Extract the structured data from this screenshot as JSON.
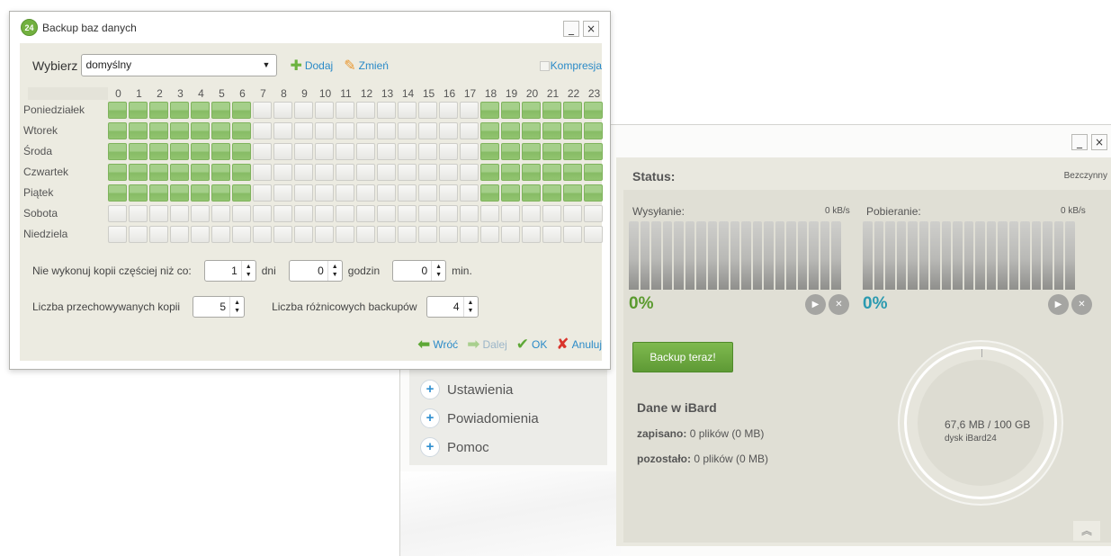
{
  "dialog": {
    "title": "Backup baz danych",
    "logo_text": "24",
    "minimize_label": "_",
    "close_label": "×",
    "wybierz_label": "Wybierz",
    "profile_value": "domyślny",
    "dodaj_label": "Dodaj",
    "zmien_label": "Zmień",
    "kompresja_label": "Kompresja",
    "kompresja_checked": false,
    "hours": [
      "0",
      "1",
      "2",
      "3",
      "4",
      "5",
      "6",
      "7",
      "8",
      "9",
      "10",
      "11",
      "12",
      "13",
      "14",
      "15",
      "16",
      "17",
      "18",
      "19",
      "20",
      "21",
      "22",
      "23"
    ],
    "days": [
      {
        "label": "Poniedziałek",
        "on": [
          1,
          1,
          1,
          1,
          1,
          1,
          1,
          0,
          0,
          0,
          0,
          0,
          0,
          0,
          0,
          0,
          0,
          0,
          1,
          1,
          1,
          1,
          1,
          1
        ]
      },
      {
        "label": "Wtorek",
        "on": [
          1,
          1,
          1,
          1,
          1,
          1,
          1,
          0,
          0,
          0,
          0,
          0,
          0,
          0,
          0,
          0,
          0,
          0,
          1,
          1,
          1,
          1,
          1,
          1
        ]
      },
      {
        "label": "Środa",
        "on": [
          1,
          1,
          1,
          1,
          1,
          1,
          1,
          0,
          0,
          0,
          0,
          0,
          0,
          0,
          0,
          0,
          0,
          0,
          1,
          1,
          1,
          1,
          1,
          1
        ]
      },
      {
        "label": "Czwartek",
        "on": [
          1,
          1,
          1,
          1,
          1,
          1,
          1,
          0,
          0,
          0,
          0,
          0,
          0,
          0,
          0,
          0,
          0,
          0,
          1,
          1,
          1,
          1,
          1,
          1
        ]
      },
      {
        "label": "Piątek",
        "on": [
          1,
          1,
          1,
          1,
          1,
          1,
          1,
          0,
          0,
          0,
          0,
          0,
          0,
          0,
          0,
          0,
          0,
          0,
          1,
          1,
          1,
          1,
          1,
          1
        ]
      },
      {
        "label": "Sobota",
        "on": [
          0,
          0,
          0,
          0,
          0,
          0,
          0,
          0,
          0,
          0,
          0,
          0,
          0,
          0,
          0,
          0,
          0,
          0,
          0,
          0,
          0,
          0,
          0,
          0
        ]
      },
      {
        "label": "Niedziela",
        "on": [
          0,
          0,
          0,
          0,
          0,
          0,
          0,
          0,
          0,
          0,
          0,
          0,
          0,
          0,
          0,
          0,
          0,
          0,
          0,
          0,
          0,
          0,
          0,
          0
        ]
      }
    ],
    "freq_label": "Nie wykonuj kopii częściej niż co:",
    "days_value": "1",
    "days_unit": "dni",
    "hours_value": "0",
    "hours_unit": "godzin",
    "min_value": "0",
    "min_unit": "min.",
    "copies_label": "Liczba przechowywanych kopii",
    "copies_value": "5",
    "diff_label": "Liczba różnicowych backupów",
    "diff_value": "4",
    "back_label": "Wróć",
    "next_label": "Dalej",
    "ok_label": "OK",
    "cancel_label": "Anuluj",
    "accent_color": "#2a8ac8",
    "active_cell_color": "#a5cf8a"
  },
  "main": {
    "minimize_label": "_",
    "close_label": "×",
    "menu": [
      {
        "label": "Ustawienia"
      },
      {
        "label": "Powiadomienia"
      },
      {
        "label": "Pomoc"
      }
    ],
    "status_label": "Status:",
    "status_value": "Bezczynny",
    "upload_label": "Wysyłanie:",
    "upload_speed": "0 kB/s",
    "upload_pct": "0%",
    "download_label": "Pobieranie:",
    "download_speed": "0 kB/s",
    "download_pct": "0%",
    "pct_color": "#5a9a2e",
    "pct2_color": "#2a9ab0",
    "backup_now_label": "Backup teraz!",
    "dane_title": "Dane w iBard",
    "saved_label": "zapisano:",
    "saved_value": "0 plików (0 MB)",
    "left_label": "pozostało:",
    "left_value": "0 plików (0 MB)",
    "disk_size": "67,6 MB / 100 GB",
    "disk_name": "dysk iBard24",
    "disk_used_fraction": 0.0007,
    "collapse_icon": "chevron-up-double-icon"
  }
}
